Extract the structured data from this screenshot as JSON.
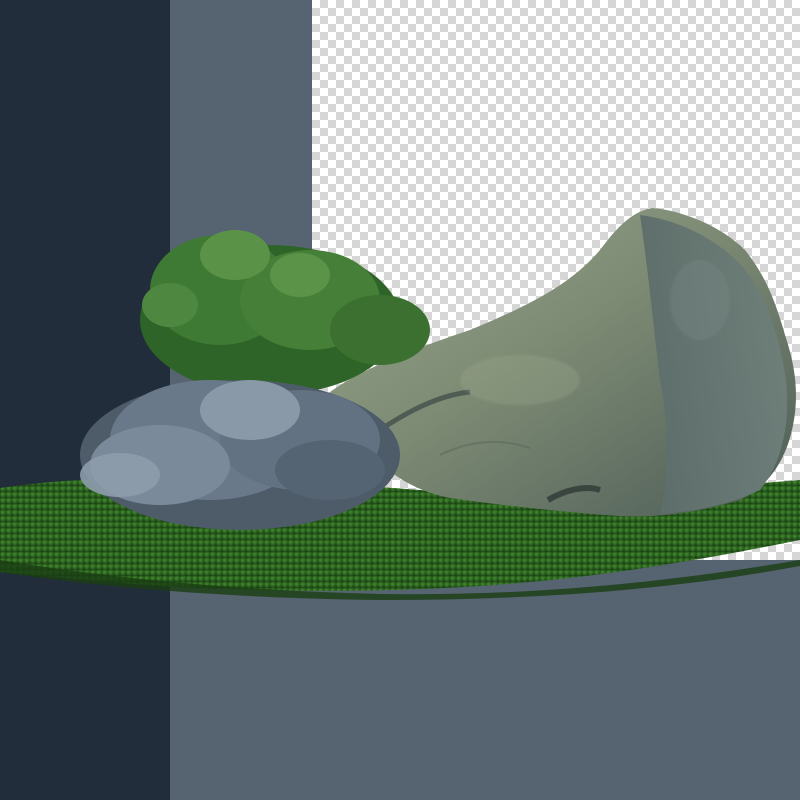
{
  "colors": {
    "dark_panel": "#212d3a",
    "slate_panel": "#566371",
    "checker_light": "#ffffff",
    "checker_dark": "#d6d6d6",
    "grass_dark": "#1f4a17",
    "grass_mid": "#2f6a22",
    "grass_light": "#4a8a33",
    "rock_base": "#6e7d6a",
    "rock_light": "#95a18a",
    "rock_shadow": "#3f4c48",
    "shrub_green": "#4a7f3a",
    "shrub_blue_gray": "#6f7f90"
  },
  "scene": {
    "subjects": [
      "grass-lawn",
      "boulder",
      "green-shrub",
      "blue-gray-shrub"
    ]
  }
}
